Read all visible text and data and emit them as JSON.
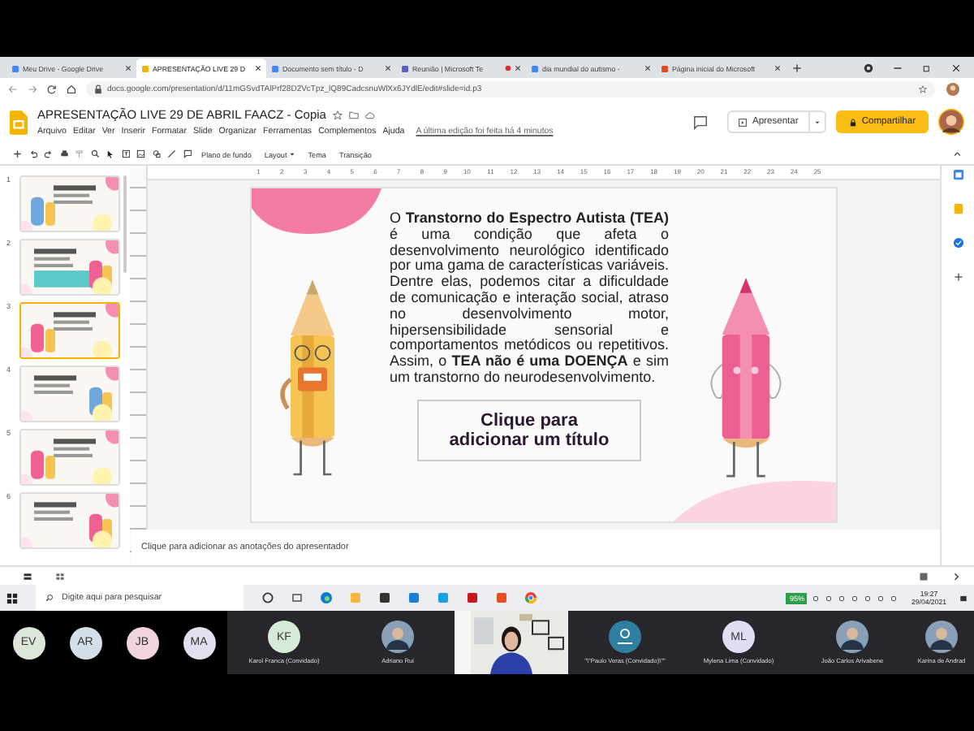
{
  "browser": {
    "tabs": [
      {
        "title": "Meu Drive - Google Drive",
        "selected": false,
        "recording": false
      },
      {
        "title": "APRESENTAÇÃO LIVE 29 D",
        "selected": true,
        "recording": false
      },
      {
        "title": "Documento sem título - D",
        "selected": false,
        "recording": false
      },
      {
        "title": "Reunião | Microsoft Te",
        "selected": false,
        "recording": true
      },
      {
        "title": "dia mundial do autismo - ",
        "selected": false,
        "recording": false
      },
      {
        "title": "Página inicial do Microsoft",
        "selected": false,
        "recording": false
      }
    ],
    "url": "docs.google.com/presentation/d/11mGSvdTAlPrf28D2VcTpz_lQ89CadcsnuWlXx6JYdlE/edit#slide=id.p3"
  },
  "app": {
    "title": "APRESENTAÇÃO LIVE 29 DE ABRIL FAACZ - Copia",
    "menus": [
      "Arquivo",
      "Editar",
      "Ver",
      "Inserir",
      "Formatar",
      "Slide",
      "Organizar",
      "Ferramentas",
      "Complementos",
      "Ajuda"
    ],
    "last_edit": "A última edição foi feita há 4 minutos",
    "present_button": "Apresentar",
    "share_button": "Compartilhar"
  },
  "toolbar": {
    "buttons": [
      {
        "label": "Plano de fundo",
        "dropdown": false
      },
      {
        "label": "Layout",
        "dropdown": true
      },
      {
        "label": "Tema",
        "dropdown": false
      },
      {
        "label": "Transição",
        "dropdown": false
      }
    ]
  },
  "ruler": [
    "1",
    "2",
    "3",
    "4",
    "5",
    "6",
    "7",
    "8",
    "9",
    "10",
    "11",
    "12",
    "13",
    "14",
    "15",
    "16",
    "17",
    "18",
    "19",
    "20",
    "21",
    "22",
    "23",
    "24",
    "25"
  ],
  "filmstrip": [
    {
      "number": "1",
      "selected": false
    },
    {
      "number": "2",
      "selected": false
    },
    {
      "number": "3",
      "selected": true
    },
    {
      "number": "4",
      "selected": false
    },
    {
      "number": "5",
      "selected": false
    },
    {
      "number": "6",
      "selected": false
    }
  ],
  "slide": {
    "body": "O **Transtorno do Espectro Autista (TEA)** é uma condição que afeta o desenvolvimento neurológico identificado por uma gama de características variáveis. Dentre elas, podemos citar a dificuldade de comunicação e interação social, atraso no desenvolvimento motor, hipersensibilidade sensorial e comportamentos metódicos ou repetitivos. Assim, o **TEA não é uma DOENÇA**  e sim um transtorno do neurodesenvolvimento.",
    "title_placeholder": "Clique para adicionar um título"
  },
  "notes": {
    "placeholder": "Clique para adicionar as anotações do apresentador"
  },
  "taskbar": {
    "search_placeholder": "Digite aqui para pesquisar",
    "battery": "95%",
    "time": "19:27",
    "date": "29/04/2021"
  },
  "participants": [
    {
      "kind": "initials",
      "initials": "EV",
      "color": "#dde6da"
    },
    {
      "kind": "initials",
      "initials": "AR",
      "color": "#d3dfe9"
    },
    {
      "kind": "initials",
      "initials": "JB",
      "color": "#f2d4df"
    },
    {
      "kind": "initials",
      "initials": "MA",
      "color": "#e3def0"
    },
    {
      "kind": "initials",
      "initials": "KF",
      "name": "Karol Franca (Convidado)",
      "color": "#d5ebd8"
    },
    {
      "name": "Adriano Rui"
    },
    {
      "kind": "video"
    },
    {
      "kind": "icon",
      "name": "\"\\\"Paulo Veras (Convidado)\\\"\""
    },
    {
      "kind": "initials",
      "initials": "ML",
      "name": "Mylena Lima (Convidado)",
      "color": "#e0def2"
    },
    {
      "name": "João Carlos Arivabene"
    },
    {
      "name": "Karina de Andrad"
    }
  ]
}
